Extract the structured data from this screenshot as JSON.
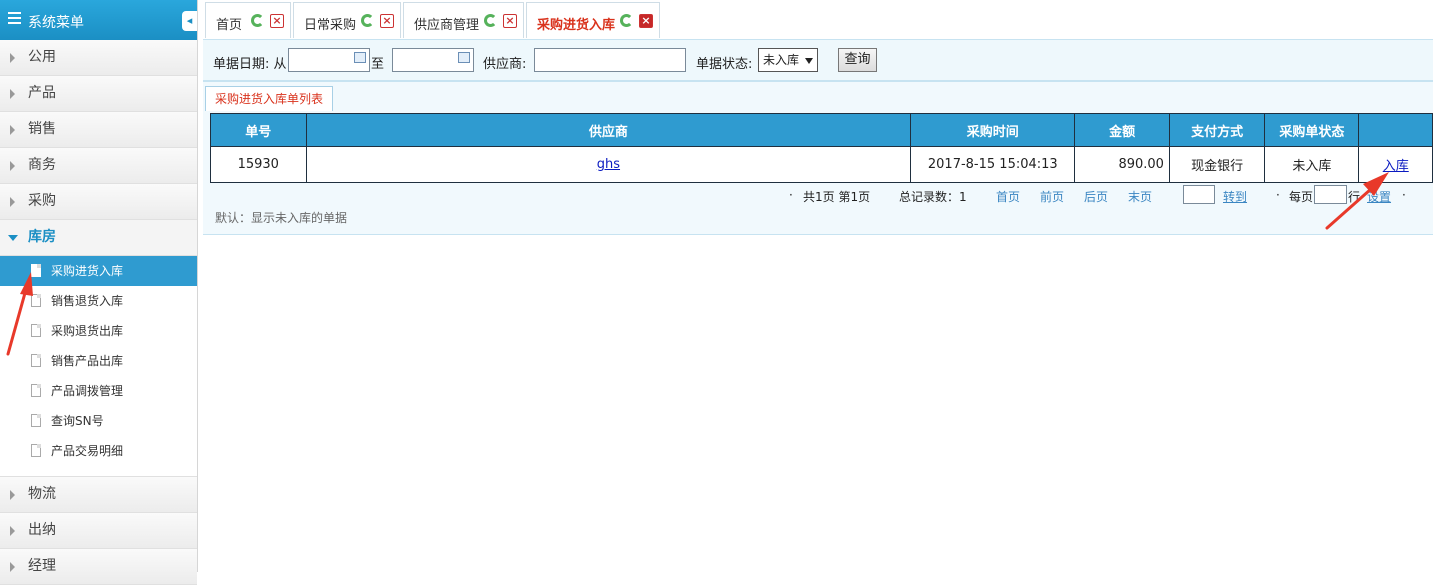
{
  "sidebar": {
    "title": "系统菜单",
    "collapse_glyph": "◂",
    "sections_top": [
      {
        "label": "公用"
      },
      {
        "label": "产品"
      },
      {
        "label": "销售"
      },
      {
        "label": "商务"
      },
      {
        "label": "采购"
      }
    ],
    "open_section": {
      "label": "库房"
    },
    "items": [
      {
        "label": "采购进货入库",
        "active": true
      },
      {
        "label": "销售退货入库"
      },
      {
        "label": "采购退货出库"
      },
      {
        "label": "销售产品出库"
      },
      {
        "label": "产品调拨管理"
      },
      {
        "label": "查询SN号"
      },
      {
        "label": "产品交易明细"
      }
    ],
    "sections_bottom": [
      {
        "label": "物流"
      },
      {
        "label": "出纳"
      },
      {
        "label": "经理"
      }
    ]
  },
  "tabs": [
    {
      "label": "首页"
    },
    {
      "label": "日常采购"
    },
    {
      "label": "供应商管理"
    },
    {
      "label": "采购进货入库",
      "active": true
    }
  ],
  "search": {
    "date_label": "单据日期: 从",
    "to_label": "至",
    "date_from": "",
    "date_to": "",
    "supplier_label": "供应商:",
    "supplier_value": "",
    "status_label": "单据状态:",
    "status_value": "未入库",
    "query_button": "查询"
  },
  "panel": {
    "tab_label": "采购进货入库单列表",
    "columns": [
      "单号",
      "供应商",
      "采购时间",
      "金额",
      "支付方式",
      "采购单状态",
      ""
    ],
    "rows": [
      {
        "no": "15930",
        "supplier": "ghs",
        "time": "2017-8-15 15:04:13",
        "amount": "890.00",
        "pay": "现金银行",
        "status": "未入库",
        "action": "入库"
      }
    ],
    "pager": {
      "dot": "·",
      "pages_info": "共1页 第1页",
      "total": "总记录数：1",
      "first": "首页",
      "prev": "前页",
      "next": "后页",
      "last": "末页",
      "goto_value": "",
      "goto": "转到",
      "per_page_label": "每页",
      "per_page_value": "",
      "rows_label": "行",
      "set": "设置"
    },
    "note": "默认：显示未入库的单据"
  },
  "colors": {
    "header_blue": "#2f9bd0",
    "active_tab_red": "#d9321c",
    "annotation_red": "#e8392a"
  }
}
